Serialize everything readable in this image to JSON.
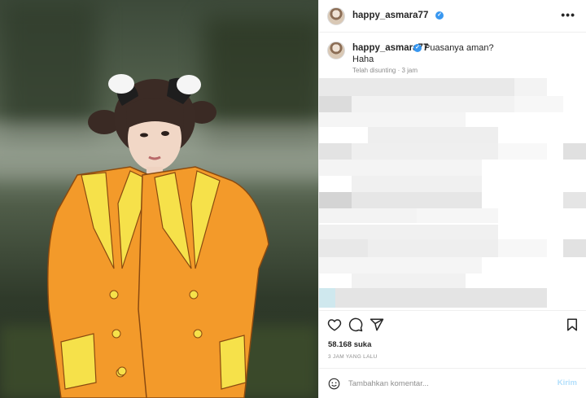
{
  "post": {
    "username": "happy_asmara77",
    "verified_mark": "✓",
    "more_icon": "more-horizontal-icon"
  },
  "comment": {
    "username": "happy_asmara77",
    "caption_line1": "Puasanya aman?",
    "caption_line2": "Haha",
    "meta": "Telah disunting · 3 jam"
  },
  "actions": {
    "icons": [
      "heart-icon",
      "comment-icon",
      "share-icon",
      "bookmark-icon"
    ],
    "likes": "58.168 suka",
    "timestamp": "3 JAM YANG LALU"
  },
  "add_comment": {
    "placeholder": "Tambahkan komentar...",
    "send_label": "Kirim"
  },
  "colors": {
    "verified": "#3897f0",
    "send_disabled": "#b2dffc",
    "jacket": "#f39a2a",
    "jacket_lapel": "#f6e14a"
  }
}
